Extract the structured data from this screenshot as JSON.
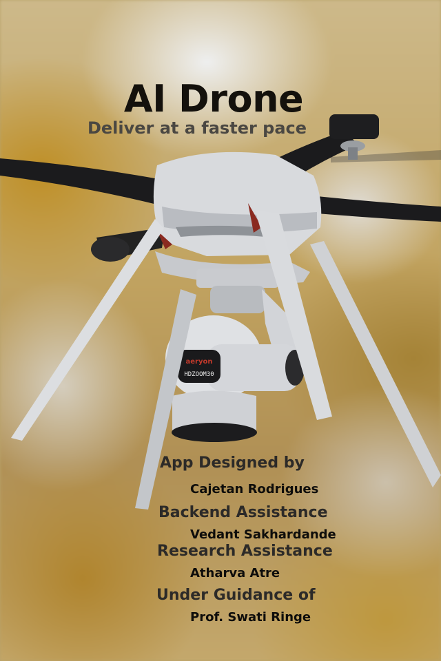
{
  "header": {
    "title": "AI Drone",
    "subtitle": "Deliver at a faster pace"
  },
  "camera": {
    "brand": "aeryon",
    "model": "HDZOOM30"
  },
  "credits": [
    {
      "role": "App Designed by",
      "name": "Cajetan Rodrigues"
    },
    {
      "role": "Backend Assistance",
      "name": "Vedant Sakhardande"
    },
    {
      "role": "Research Assistance",
      "name": "Atharva Atre"
    },
    {
      "role": "Under Guidance of",
      "name": "Prof. Swati Ringe"
    }
  ]
}
